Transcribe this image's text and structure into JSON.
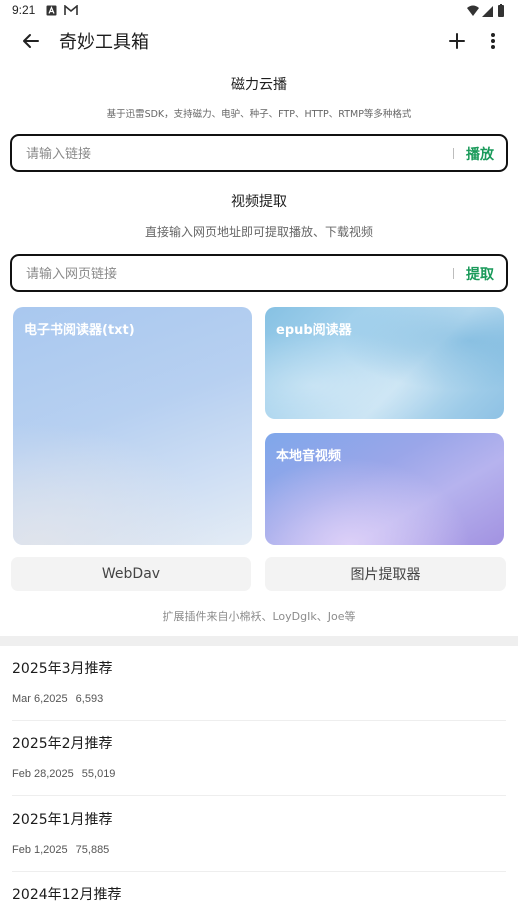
{
  "status": {
    "time": "9:21",
    "icons": [
      "a-icon",
      "m-icon"
    ],
    "right_icons": [
      "wifi-icon",
      "signal-icon",
      "battery-icon"
    ]
  },
  "appbar": {
    "title": "奇妙工具箱",
    "back_icon": "arrow-left-icon",
    "add_icon": "plus-icon",
    "more_icon": "more-vertical-icon"
  },
  "magnet": {
    "title": "磁力云播",
    "subtitle": "基于迅雷SDK，支持磁力、电驴、种子、FTP、HTTP、RTMP等多种格式",
    "placeholder": "请输入链接",
    "button": "播放"
  },
  "video": {
    "title": "视频提取",
    "subtitle": "直接输入网页地址即可提取播放、下载视频",
    "placeholder": "请输入网页链接",
    "button": "提取"
  },
  "cards": {
    "ebook": "电子书阅读器(txt)",
    "epub": "epub阅读器",
    "local": "本地音视频"
  },
  "buttons": {
    "webdav": "WebDav",
    "pic": "图片提取器"
  },
  "credits": "扩展插件来自小棉袄、LoyDgIk、Joe等",
  "list": [
    {
      "title": "2025年3月推荐",
      "date": "Mar 6,2025",
      "count": "6,593"
    },
    {
      "title": "2025年2月推荐",
      "date": "Feb 28,2025",
      "count": "55,019"
    },
    {
      "title": "2025年1月推荐",
      "date": "Feb 1,2025",
      "count": "75,885"
    },
    {
      "title": "2024年12月推荐",
      "date": "",
      "count": ""
    }
  ],
  "colors": {
    "accent_green": "#1a9a5a",
    "border": "#111111"
  }
}
